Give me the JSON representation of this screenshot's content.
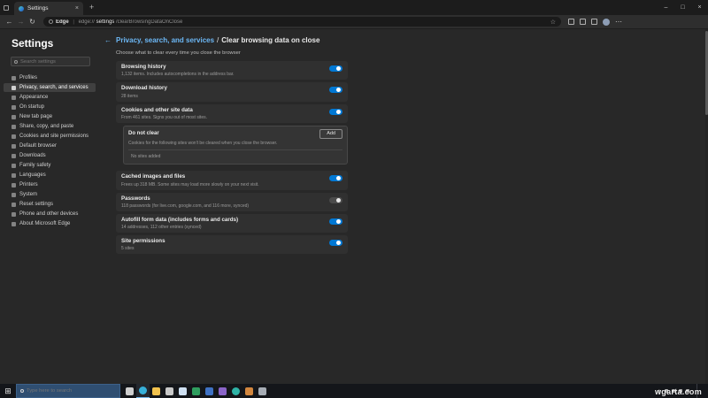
{
  "chrome": {
    "tab": {
      "title": "Settings",
      "close_glyph": "×"
    },
    "new_tab_glyph": "+",
    "window_controls": {
      "minimize": "–",
      "maximize": "□",
      "close": "×"
    },
    "nav": {
      "back": "←",
      "forward": "→",
      "refresh": "↻"
    },
    "address": {
      "site_label": "Edge",
      "divider": "|",
      "scheme": "edge://",
      "host": "settings",
      "path": "/clearBrowsingDataOnClose",
      "favorite_glyph": "☆"
    },
    "more_glyph": "⋯"
  },
  "sidebar": {
    "title": "Settings",
    "search_placeholder": "Search settings",
    "items": [
      {
        "label": "Profiles"
      },
      {
        "label": "Privacy, search, and services",
        "selected": true
      },
      {
        "label": "Appearance"
      },
      {
        "label": "On startup"
      },
      {
        "label": "New tab page"
      },
      {
        "label": "Share, copy, and paste"
      },
      {
        "label": "Cookies and site permissions"
      },
      {
        "label": "Default browser"
      },
      {
        "label": "Downloads"
      },
      {
        "label": "Family safety"
      },
      {
        "label": "Languages"
      },
      {
        "label": "Printers"
      },
      {
        "label": "System"
      },
      {
        "label": "Reset settings"
      },
      {
        "label": "Phone and other devices"
      },
      {
        "label": "About Microsoft Edge"
      }
    ]
  },
  "main": {
    "breadcrumb": {
      "back_glyph": "←",
      "parent": "Privacy, search, and services",
      "separator": "/",
      "current": "Clear browsing data on close"
    },
    "subtitle": "Choose what to clear every time you close the browser",
    "rows": [
      {
        "title": "Browsing history",
        "description": "1,132 items. Includes autocompletions in the address bar.",
        "state": "on"
      },
      {
        "title": "Download history",
        "description": "28 items",
        "state": "on"
      },
      {
        "title": "Cookies and other site data",
        "description": "From 461 sites. Signs you out of most sites.",
        "state": "on"
      },
      {
        "title": "Cached images and files",
        "description": "Frees up 318 MB. Some sites may load more slowly on your next visit.",
        "state": "on"
      },
      {
        "title": "Passwords",
        "description": "118 passwords (for live.com, google.com, and 116 more, synced)",
        "state": "dim"
      },
      {
        "title": "Autofill form data (includes forms and cards)",
        "description": "14 addresses, 112 other entries (synced)",
        "state": "on"
      },
      {
        "title": "Site permissions",
        "description": "5 sites",
        "state": "on"
      }
    ],
    "do_not_clear": {
      "title": "Do not clear",
      "add_button": "Add",
      "description": "Cookies for the following sites won't be cleared when you close the browser.",
      "empty_text": "No sites added"
    }
  },
  "taskbar": {
    "start_glyph": "⊞",
    "search_placeholder": "Type here to search",
    "apps": [
      {
        "name": "task-view",
        "color": "#cfcfcf"
      },
      {
        "name": "edge-browser",
        "color": "#36b0d9"
      },
      {
        "name": "file-explorer",
        "color": "#f2c24d"
      },
      {
        "name": "microsoft-store",
        "color": "#c9c9c9"
      },
      {
        "name": "mail",
        "color": "#cfe0f2"
      },
      {
        "name": "app-green",
        "color": "#2f9e5f"
      },
      {
        "name": "app-blue",
        "color": "#3f72c4"
      },
      {
        "name": "app-purple",
        "color": "#8a64c8"
      },
      {
        "name": "app-teal",
        "color": "#2fb3a6"
      },
      {
        "name": "app-orange",
        "color": "#d3873e"
      },
      {
        "name": "app-gray",
        "color": "#a7adb5"
      }
    ],
    "tray_chevron": "∧"
  },
  "watermark": "wgarta.com",
  "colors": {
    "accent": "#0078d4",
    "link": "#6cb8f6"
  }
}
